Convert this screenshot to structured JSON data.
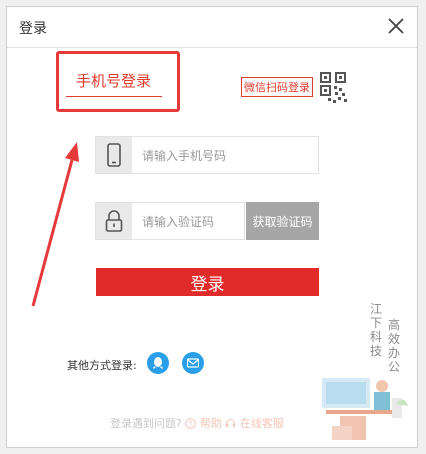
{
  "window": {
    "title": "登录"
  },
  "tabs": {
    "phone_login": "手机号登录",
    "wechat_login": "微信扫码登录"
  },
  "phone_input": {
    "placeholder": "请输入手机号码"
  },
  "code_input": {
    "placeholder": "请输入验证码",
    "get_code_label": "获取验证码"
  },
  "login_button": {
    "label": "登录"
  },
  "other_login": {
    "label": "其他方式登录:",
    "icons": [
      "qq-icon",
      "email-icon"
    ]
  },
  "footer": {
    "problem": "登录遇到问题?",
    "help": "帮助",
    "service": "在线客服"
  },
  "watermark": {
    "col1": "江下科技",
    "col2": "高效办公"
  },
  "colors": {
    "accent": "#e03c2e",
    "button": "#e12a2a",
    "blue": "#2a9ee8",
    "gray_button": "#a6a6a6"
  }
}
